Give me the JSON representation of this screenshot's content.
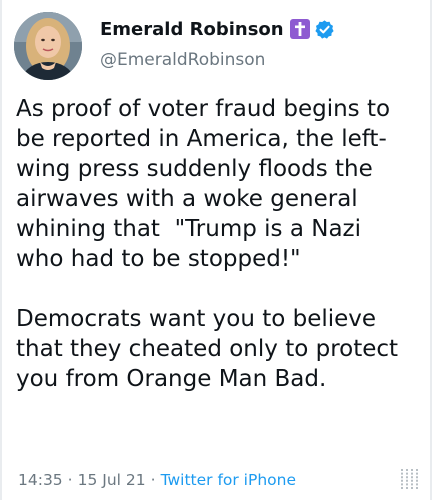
{
  "tweet": {
    "author": {
      "display_name": "Emerald Robinson",
      "handle": "@EmeraldRobinson"
    },
    "text_paragraphs": [
      "As proof of voter fraud begins to\nbe reported in America, the left-\nwing press suddenly floods the\nairwaves with a woke general\nwhining that  \"Trump is a Nazi\nwho had to be stopped!\"",
      "Democrats want you to believe\nthat they cheated only to protect\nyou from Orange Man Bad."
    ],
    "footer": {
      "time": "14:35",
      "date": "15 Jul 21",
      "source": "Twitter for iPhone",
      "separator": "·"
    }
  },
  "icons": {
    "cross_badge": "latin-cross-icon",
    "verified_badge": "verified-check-icon",
    "menu": "vertical-lines-icon"
  },
  "colors": {
    "cross_badge_bg": "#8e5bd1",
    "verified_blue": "#1d9bf0",
    "source_link": "#1d9bf0",
    "secondary_text": "#6b7780"
  }
}
